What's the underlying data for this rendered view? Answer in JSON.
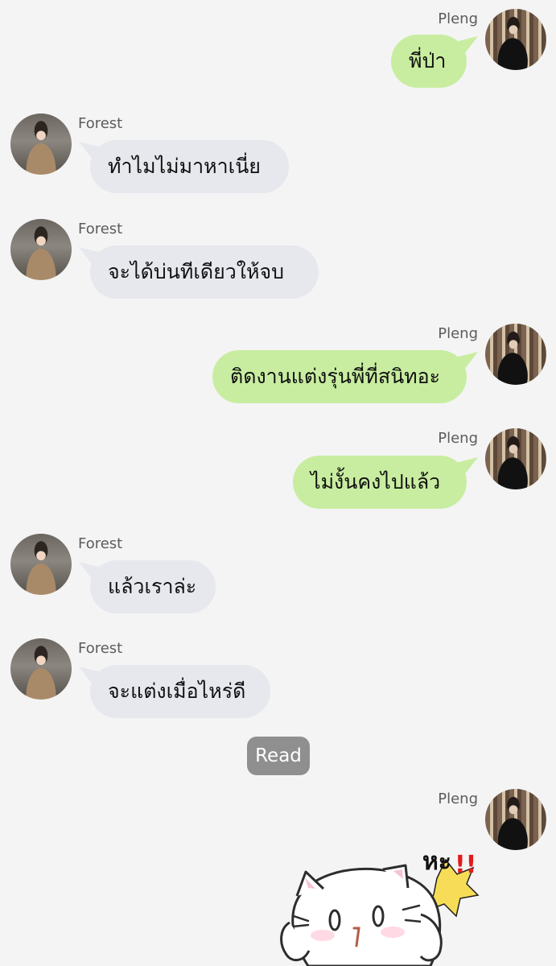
{
  "colors": {
    "background": "#f4f4f4",
    "incoming_bubble": "#e6e8ed",
    "outgoing_bubble": "#c8eda0",
    "read_badge": "#8f8f8f"
  },
  "messages": [
    {
      "sender": "Pleng",
      "direction": "outgoing",
      "text": "พี่ป่า"
    },
    {
      "sender": "Forest",
      "direction": "incoming",
      "text": "ทำไมไม่มาหาเนี่ย"
    },
    {
      "sender": "Forest",
      "direction": "incoming",
      "text": "จะได้บ่นทีเดียวให้จบ"
    },
    {
      "sender": "Pleng",
      "direction": "outgoing",
      "text": "ติดงานแต่งรุ่นพี่ที่สนิทอะ"
    },
    {
      "sender": "Pleng",
      "direction": "outgoing",
      "text": "ไม่งั้นคงไปแล้ว"
    },
    {
      "sender": "Forest",
      "direction": "incoming",
      "text": "แล้วเราล่ะ"
    },
    {
      "sender": "Forest",
      "direction": "incoming",
      "text": "จะแต่งเมื่อไหร่ดี"
    },
    {
      "sender": "Pleng",
      "direction": "outgoing",
      "type": "sticker",
      "sticker": "white-cat-sticker",
      "text": "หะ!!"
    }
  ],
  "read_status": "Read",
  "icons": {
    "forest_avatar": "forest-avatar-icon",
    "pleng_avatar": "pleng-avatar-icon",
    "sticker": "white-cat-sticker-icon"
  }
}
